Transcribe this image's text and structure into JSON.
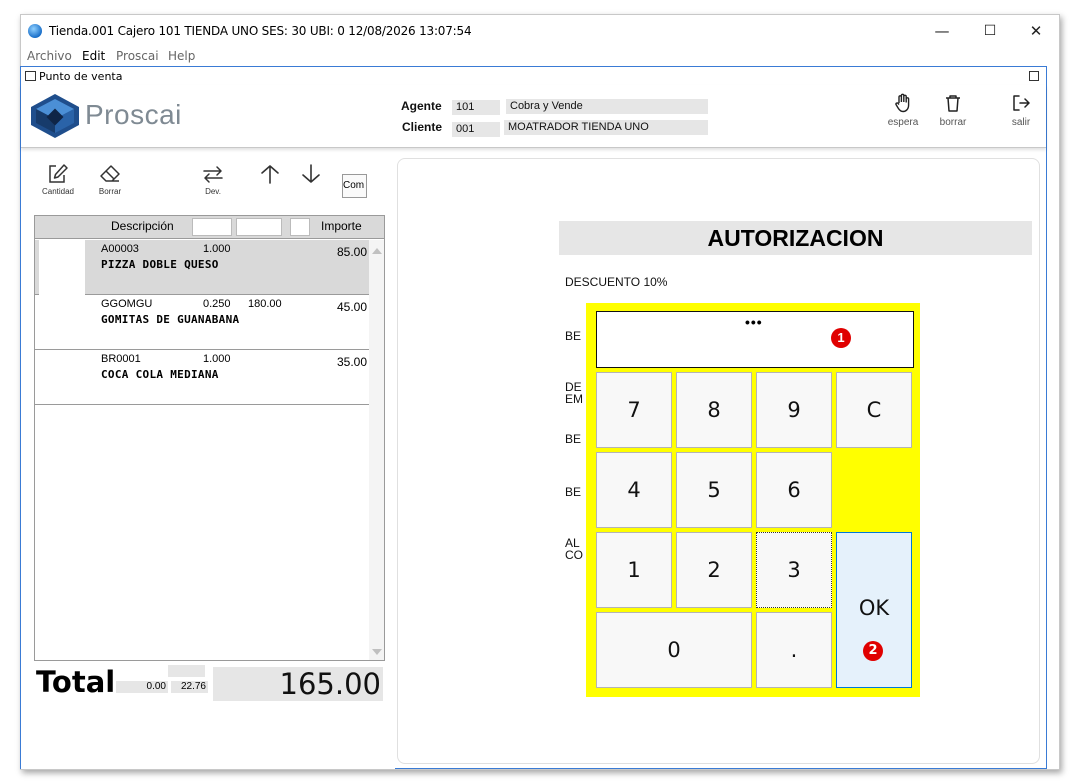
{
  "window": {
    "title": "Tienda.001  Cajero 101  TIENDA UNO    SES: 30   UBI: 0   12/08/2026 13:07:54",
    "minimize": "—",
    "maximize": "☐",
    "close": "✕"
  },
  "menu": {
    "items": [
      "Archivo",
      "Edit",
      "Proscai",
      "Help"
    ]
  },
  "pos": {
    "panel_title": "Punto de venta",
    "logo_text": "Proscai",
    "agente_label": "Agente",
    "agente_code": "101",
    "agente_name": "Cobra y Vende",
    "cliente_label": "Cliente",
    "cliente_code": "001",
    "cliente_name": "MOATRADOR TIENDA UNO",
    "actions": {
      "espera": "espera",
      "borrar": "borrar",
      "salir": "salir"
    }
  },
  "toolbar": {
    "cantidad": "Cantidad",
    "borrar": "Borrar",
    "dev": "Dev.",
    "com": "Com"
  },
  "table": {
    "headers": {
      "descripcion": "Descripción",
      "importe": "Importe"
    },
    "rows": [
      {
        "code": "A00003",
        "qty": "1.000",
        "price": "",
        "amount": "85.00",
        "desc": "PIZZA DOBLE QUESO"
      },
      {
        "code": "GGOMGU",
        "qty": "0.250",
        "price": "180.00",
        "amount": "45.00",
        "desc": "GOMITAS DE GUANABANA"
      },
      {
        "code": "BR0001",
        "qty": "1.000",
        "price": "",
        "amount": "35.00",
        "desc": "COCA COLA MEDIANA"
      }
    ]
  },
  "totals": {
    "label": "Total",
    "discount": "0.00",
    "tax": "22.76",
    "total": "165.00"
  },
  "auth": {
    "title": "AUTORIZACION",
    "items": [
      "DESCUENTO 10%",
      "BE",
      "DE",
      "EM",
      "BE",
      "BE",
      "AL",
      "CO"
    ]
  },
  "keypad": {
    "masked_value": "•••",
    "keys": [
      "7",
      "8",
      "9",
      "C",
      "4",
      "5",
      "6",
      "1",
      "2",
      "3",
      "0",
      "."
    ],
    "ok": "OK",
    "badge_1": "1",
    "badge_2": "2"
  },
  "colors": {
    "keypad_bg": "#ffff00",
    "badge": "#e00000",
    "ok_bg": "#e5f1fb",
    "ok_border": "#0078d7",
    "logo": "#1f4e8c"
  }
}
